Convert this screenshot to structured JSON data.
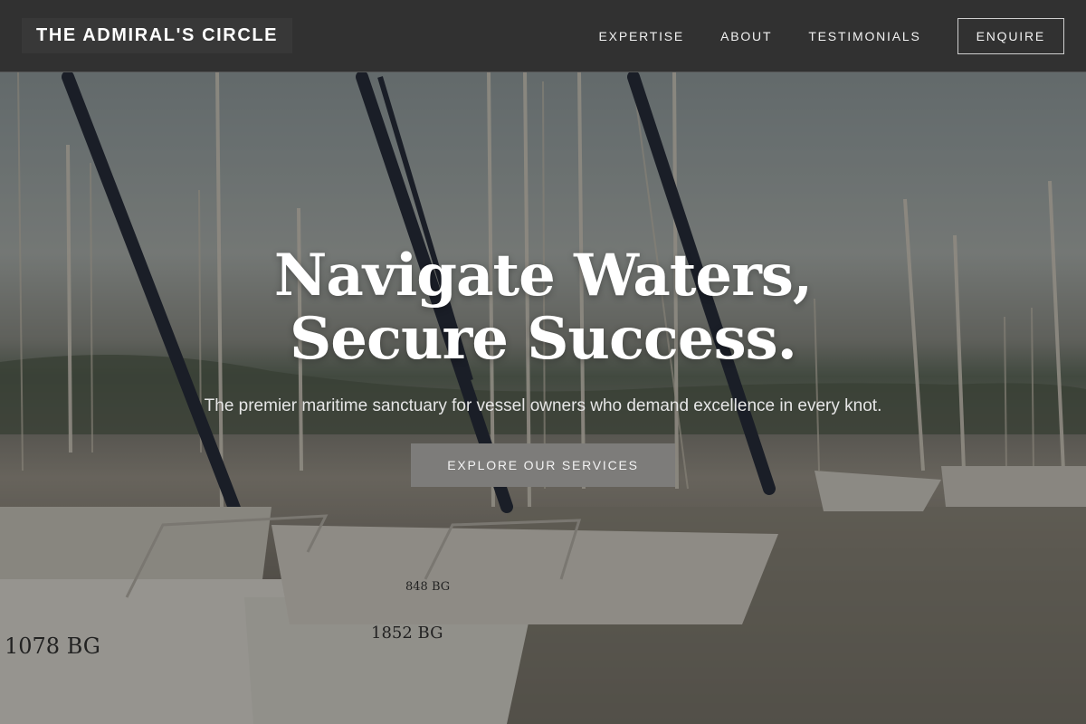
{
  "header": {
    "brand": "THE ADMIRAL'S CIRCLE",
    "nav": {
      "expertise": "EXPERTISE",
      "about": "ABOUT",
      "testimonials": "TESTIMONIALS",
      "enquire": "ENQUIRE"
    }
  },
  "hero": {
    "headline_line1": "Navigate Waters,",
    "headline_line2": "Secure Success.",
    "subheadline": "The premier maritime sanctuary for vessel owners who demand excellence in every knot.",
    "cta_label": "EXPLORE OUR SERVICES",
    "background_image": "marina-sailboats-photo",
    "boat_labels": [
      "1078 BG",
      "1852 BG",
      "848 BG"
    ]
  },
  "colors": {
    "nav_background": "#303030",
    "cta_background": "#7d7c7a",
    "text_primary": "#ffffff"
  }
}
